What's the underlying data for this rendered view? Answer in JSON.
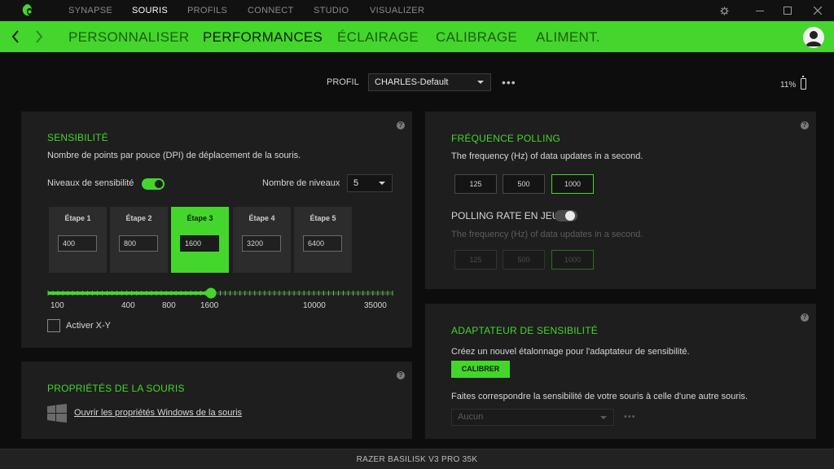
{
  "titlebar": {
    "nav": [
      "SYNAPSE",
      "SOURIS",
      "PROFILS",
      "CONNECT",
      "STUDIO",
      "VISUALIZER"
    ],
    "active_nav": "SOURIS",
    "icons": [
      "settings-icon",
      "minimize-icon",
      "maximize-icon",
      "close-icon"
    ]
  },
  "subnav": {
    "tabs": [
      "PERSONNALISER",
      "PERFORMANCES",
      "ÉCLAIRAGE",
      "CALIBRAGE",
      "ALIMENT."
    ],
    "active_tab": "PERFORMANCES"
  },
  "profile": {
    "label": "PROFIL",
    "value": "CHARLES-Default",
    "more": "•••"
  },
  "battery": {
    "percent_text": "11%"
  },
  "sensitivity": {
    "title": "SENSIBILITÉ",
    "description": "Nombre de points par pouce (DPI) de déplacement de la souris.",
    "levels_label": "Niveaux de sensibilité",
    "levels_enabled": true,
    "count_label": "Nombre de niveaux",
    "count_value": "5",
    "stages": [
      {
        "label": "Étape 1",
        "value": "400"
      },
      {
        "label": "Étape 2",
        "value": "800"
      },
      {
        "label": "Étape 3",
        "value": "1600"
      },
      {
        "label": "Étape 4",
        "value": "3200"
      },
      {
        "label": "Étape 5",
        "value": "6400"
      }
    ],
    "active_stage": 3,
    "slider_ticks": [
      "100",
      "400",
      "800",
      "1600",
      "10000",
      "35000"
    ],
    "slider_value": "1600",
    "xy_label": "Activer X-Y",
    "xy_checked": false
  },
  "mouse_props": {
    "title": "PROPRIÉTÉS DE LA SOURIS",
    "link": "Ouvrir les propriétés Windows de la souris"
  },
  "polling": {
    "title": "FRÉQUENCE POLLING",
    "description": "The frequency (Hz) of data updates in a second.",
    "options": [
      "125",
      "500",
      "1000"
    ],
    "selected": "1000",
    "ingame_label": "POLLING RATE EN JEU",
    "ingame_enabled": false,
    "ingame_description": "The frequency (Hz) of data updates in a second.",
    "ingame_options": [
      "125",
      "500",
      "1000"
    ],
    "ingame_selected": "1000"
  },
  "adapter": {
    "title": "ADAPTATEUR DE SENSIBILITÉ",
    "description": "Créez un nouvel étalonnage pour l'adaptateur de sensibilité.",
    "button": "CALIBRER",
    "match_text": "Faites correspondre la sensibilité de votre souris à celle d'une autre souris.",
    "select_value": "Aucun",
    "more": "•••"
  },
  "help_icon": "?",
  "device_name": "RAZER BASILISK V3 PRO 35K",
  "colors": {
    "accent": "#44d62c",
    "background": "#0d0d0d",
    "panel": "#1e1e1e"
  }
}
